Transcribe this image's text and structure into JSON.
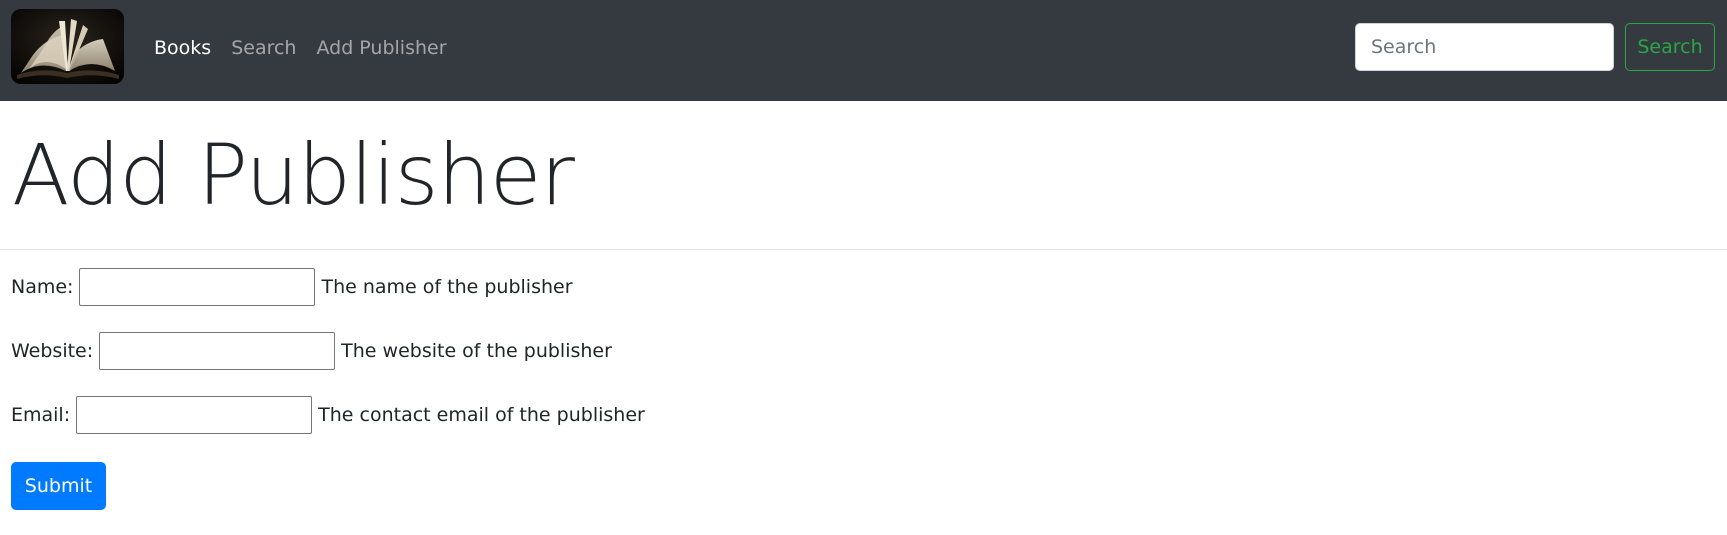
{
  "navbar": {
    "logo": "open-book-logo",
    "links": [
      {
        "label": "Books",
        "active": true
      },
      {
        "label": "Search",
        "active": false
      },
      {
        "label": "Add Publisher",
        "active": false
      }
    ],
    "search": {
      "placeholder": "Search",
      "button_label": "Search"
    }
  },
  "page": {
    "title": "Add Publisher"
  },
  "form": {
    "fields": [
      {
        "label": "Name:",
        "value": "",
        "help": "The name of the publisher"
      },
      {
        "label": "Website:",
        "value": "",
        "help": "The website of the publisher"
      },
      {
        "label": "Email:",
        "value": "",
        "help": "The contact email of the publisher"
      }
    ],
    "submit_label": "Submit"
  },
  "colors": {
    "navbar_bg": "#343a40",
    "primary": "#007bff",
    "success": "#28a745"
  }
}
